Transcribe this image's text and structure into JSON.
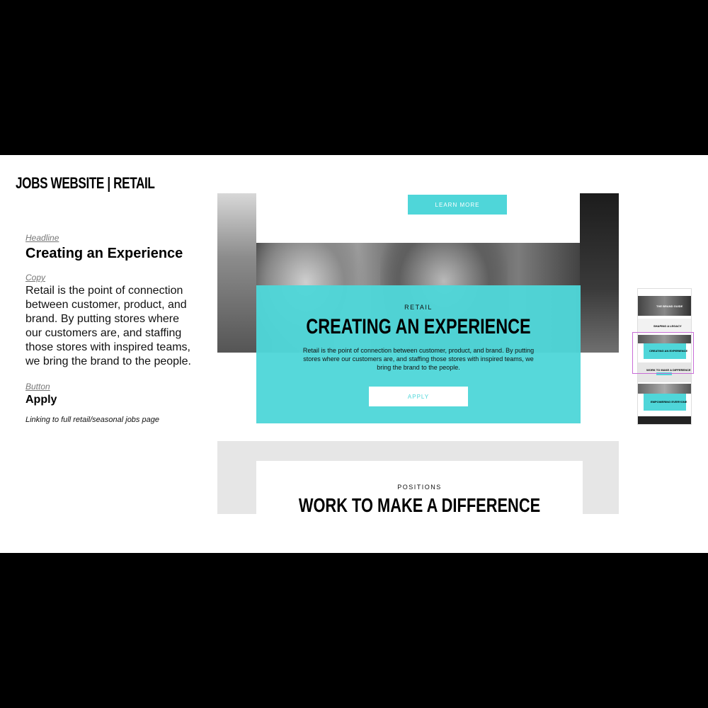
{
  "deck": {
    "title": "JOBS WEBSITE | RETAIL"
  },
  "spec": {
    "headline_label": "Headline",
    "headline": "Creating an Experience",
    "copy_label": "Copy",
    "copy": "Retail is the point of connection between customer, product, and brand. By putting stores where our customers are, and staffing those stores with inspired teams, we bring the brand to the people.",
    "button_label": "Button",
    "button": "Apply",
    "note": "Linking to full retail/seasonal jobs page"
  },
  "mockup": {
    "learn_more": "LEARN MORE",
    "hero": {
      "eyebrow": "RETAIL",
      "title": "CREATING AN EXPERIENCE",
      "copy": "Retail is the point of connection between customer, product, and brand. By putting stores where our customers are, and staffing those stores with inspired teams, we bring the brand to the people.",
      "button": "APPLY"
    },
    "positions": {
      "eyebrow": "POSITIONS",
      "title": "WORK TO MAKE A DIFFERENCE"
    }
  },
  "thumbnail": {
    "section_1": "THE BRAND GUIDE",
    "section_2": "SHAPING A LEGACY",
    "section_3": "CREATING AN EXPERIENCE",
    "section_4": "WORK TO MAKE A DIFFERENCE",
    "section_5": "EMPOWERING EVERYONE"
  },
  "colors": {
    "accent": "#4fd6d9",
    "highlight_frame": "#c86dd7",
    "letterbox": "#000000"
  }
}
